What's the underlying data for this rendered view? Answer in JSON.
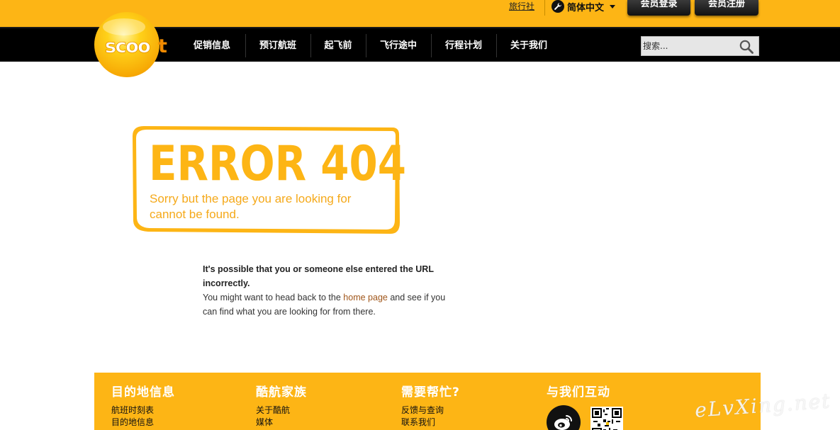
{
  "topbar": {
    "agency_link": "旅行社",
    "language": "简体中文",
    "login_button": "会员登录",
    "register_button": "会员注册"
  },
  "logo": {
    "brand": "scoot"
  },
  "nav": {
    "items": [
      {
        "label": "促销信息"
      },
      {
        "label": "预订航班"
      },
      {
        "label": "起飞前"
      },
      {
        "label": "飞行途中"
      },
      {
        "label": "行程计划"
      },
      {
        "label": "关于我们"
      }
    ],
    "search_placeholder": "搜索..."
  },
  "error": {
    "title": "ERROR 404",
    "subtitle": "Sorry but the page you are looking for cannot be found."
  },
  "message": {
    "line1": "It's possible that you or someone else entered the URL incorrectly.",
    "line2_before": "You might want to head back to the ",
    "link": "home page",
    "line2_after": " and see if you can find what you are looking for from there."
  },
  "footer": {
    "columns": [
      {
        "title": "目的地信息",
        "links": [
          "航班时刻表",
          "目的地信息"
        ]
      },
      {
        "title": "酷航家族",
        "links": [
          "关于酷航",
          "媒体"
        ]
      },
      {
        "title": "需要帮忙?",
        "links": [
          "反馈与查询",
          "联系我们"
        ]
      },
      {
        "title": "与我们互动",
        "links": []
      }
    ]
  },
  "watermark": "eLvXing.net",
  "colors": {
    "brand_yellow": "#fdb515",
    "nav_black": "#000000",
    "link_brown": "#a0561a"
  },
  "icons": [
    "wrench-icon",
    "caret-down-icon",
    "search-icon",
    "weibo-icon",
    "qr-code"
  ]
}
